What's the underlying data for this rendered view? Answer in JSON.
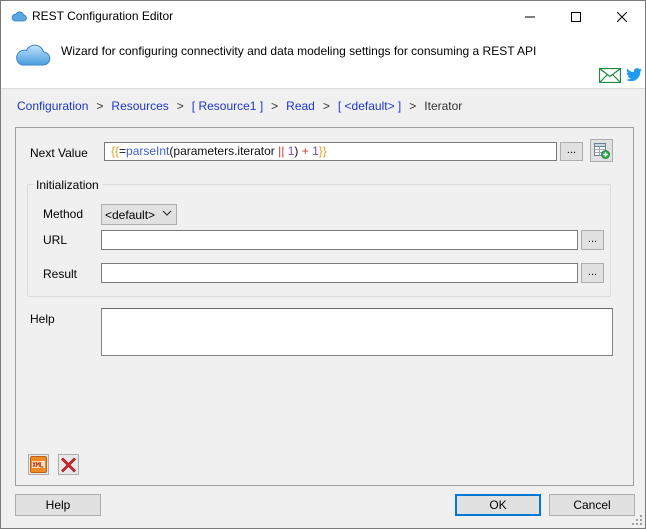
{
  "window": {
    "title": "REST Configuration Editor",
    "header_text": "Wizard for configuring connectivity and data modeling settings for consuming a REST API"
  },
  "icons": {
    "app": "cloud-icon",
    "header": "cloud-icon",
    "mail": "mail-icon",
    "twitter": "twitter-bird-icon",
    "minimize": "minimize-icon",
    "maximize": "maximize-icon",
    "close": "close-icon",
    "add_field": "add-table-icon",
    "xml": "xml-icon",
    "delete": "red-x-icon",
    "dropdown": "chevron-down-icon"
  },
  "breadcrumb": {
    "separator": ">",
    "items": [
      {
        "label": "Configuration"
      },
      {
        "label": "Resources"
      },
      {
        "label": "[ Resource1 ]"
      },
      {
        "label": "Read"
      },
      {
        "label": "[ <default> ]"
      }
    ],
    "current": "Iterator"
  },
  "form": {
    "next_value_label": "Next Value",
    "next_value_expr": {
      "open": "{{",
      "eq": "=",
      "fn": "parseInt",
      "paren_open": "(",
      "arg": "parameters.iterator",
      "op_or": "||",
      "one_a": "1",
      "paren_close": ")",
      "op_plus": "+",
      "one_b": "1",
      "close": "}}"
    },
    "browse_label": "...",
    "initialization_label": "Initialization",
    "method_label": "Method",
    "method_value": "<default>",
    "url_label": "URL",
    "url_value": "",
    "result_label": "Result",
    "result_value": "",
    "help_label": "Help",
    "help_value": ""
  },
  "footer": {
    "help_button": "Help",
    "ok_button": "OK",
    "cancel_button": "Cancel"
  },
  "colors": {
    "link": "#1f35c8",
    "brace": "#e6a023",
    "function": "#3a5fd6",
    "operator": "#d2382c",
    "number": "#7a4cc2",
    "ok_border": "#0078d7"
  }
}
